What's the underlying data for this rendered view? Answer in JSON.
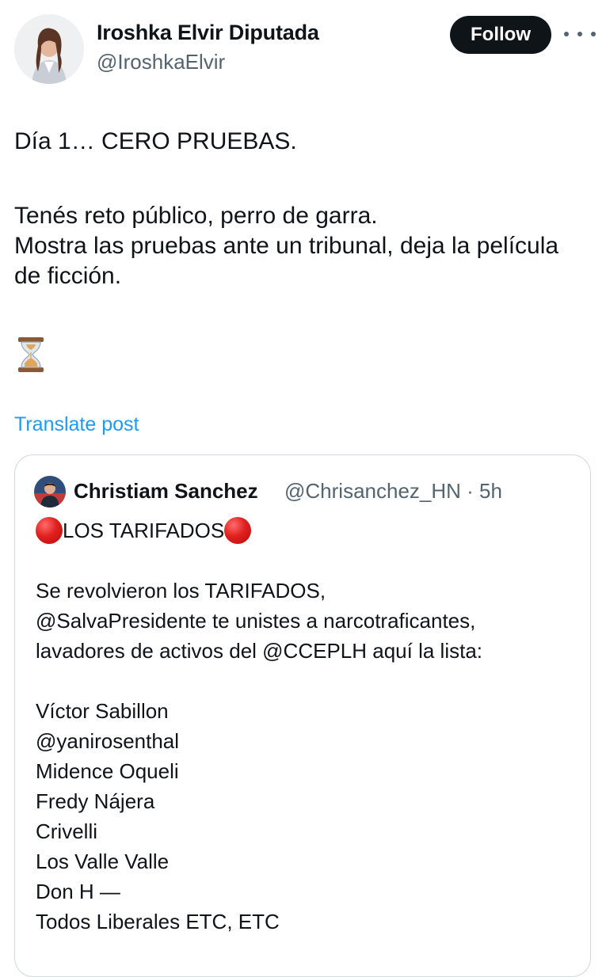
{
  "author": {
    "name": "Iroshka Elvir Diputada",
    "handle": "@IroshkaElvir",
    "follow_label": "Follow"
  },
  "post": {
    "line1": "Día 1… CERO PRUEBAS.",
    "paragraph2": "Tenés reto público, perro de garra.\nMostra las pruebas ante un tribunal, deja la película de ficción.",
    "emoji": "hourglass-icon",
    "translate_label": "Translate post"
  },
  "quoted": {
    "name": "Christiam Sanchez",
    "handle_time": "@Chrisanchez_HN · 5h",
    "title": "LOS TARIFADOS",
    "paragraph": "Se revolvieron los TARIFADOS,\n@SalvaPresidente te unistes a narcotraficantes,\nlavadores de activos del @CCEPLH aquí la lista:",
    "list": [
      "Víctor Sabillon",
      "@yanirosenthal",
      "Midence Oqueli",
      "Fredy Nájera",
      "Crivelli",
      "Los Valle Valle",
      "Don H —",
      "Todos Liberales ETC, ETC"
    ]
  },
  "colors": {
    "accent": "#1d9bf0",
    "text": "#0f1419",
    "muted": "#536471",
    "border": "#cfd9de"
  }
}
